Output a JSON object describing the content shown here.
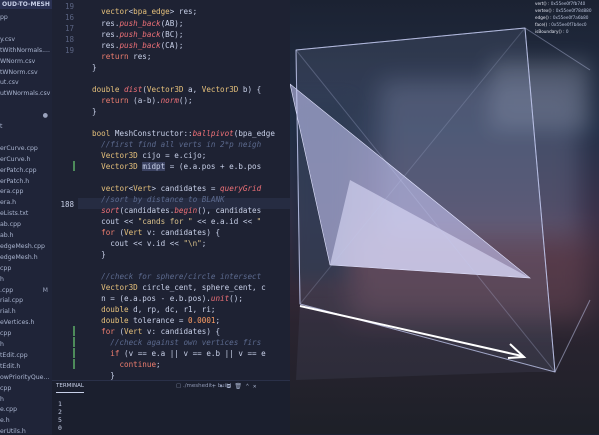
{
  "explorer": {
    "header": "OUD-TO-MESH",
    "files": [
      {
        "name": "pp",
        "marker": ""
      },
      {
        "name": "",
        "marker": ""
      },
      {
        "name": "y.csv",
        "marker": ""
      },
      {
        "name": "tWithNormals....",
        "marker": ""
      },
      {
        "name": "WNorm.csv",
        "marker": ""
      },
      {
        "name": "tWNorm.csv",
        "marker": ""
      },
      {
        "name": "ut.csv",
        "marker": ""
      },
      {
        "name": "utWNormals.csv",
        "marker": ""
      },
      {
        "name": "",
        "marker": ""
      },
      {
        "name": "",
        "marker": "●"
      },
      {
        "name": "t",
        "marker": ""
      },
      {
        "name": "",
        "marker": ""
      },
      {
        "name": "erCurve.cpp",
        "marker": ""
      },
      {
        "name": "erCurve.h",
        "marker": ""
      },
      {
        "name": "erPatch.cpp",
        "marker": ""
      },
      {
        "name": "erPatch.h",
        "marker": ""
      },
      {
        "name": "era.cpp",
        "marker": ""
      },
      {
        "name": "era.h",
        "marker": ""
      },
      {
        "name": "eLists.txt",
        "marker": ""
      },
      {
        "name": "ab.cpp",
        "marker": ""
      },
      {
        "name": "ab.h",
        "marker": ""
      },
      {
        "name": "edgeMesh.cpp",
        "marker": ""
      },
      {
        "name": "edgeMesh.h",
        "marker": ""
      },
      {
        "name": "cpp",
        "marker": ""
      },
      {
        "name": "h",
        "marker": ""
      },
      {
        "name": ".cpp",
        "marker": "M"
      },
      {
        "name": "rial.cpp",
        "marker": ""
      },
      {
        "name": "rial.h",
        "marker": ""
      },
      {
        "name": "eVertices.h",
        "marker": ""
      },
      {
        "name": "cpp",
        "marker": ""
      },
      {
        "name": "h",
        "marker": ""
      },
      {
        "name": "tEdit.cpp",
        "marker": ""
      },
      {
        "name": "tEdit.h",
        "marker": ""
      },
      {
        "name": "owPriorityQue...",
        "marker": ""
      },
      {
        "name": "cpp",
        "marker": ""
      },
      {
        "name": "h",
        "marker": ""
      },
      {
        "name": "e.cpp",
        "marker": ""
      },
      {
        "name": "e.h",
        "marker": ""
      },
      {
        "name": "erUtils.h",
        "marker": ""
      }
    ]
  },
  "editor": {
    "line_numbers": [
      "19",
      "16",
      "17",
      "18",
      "19",
      "",
      "",
      "",
      "",
      "",
      "",
      "",
      "",
      "",
      "",
      "",
      "",
      "",
      "188",
      "",
      "",
      "",
      "",
      "",
      "",
      "",
      "",
      "",
      "",
      "",
      "",
      "",
      "",
      "",
      "",
      ""
    ],
    "current_line": 188
  },
  "terminal": {
    "tab_label": "TERMINAL",
    "task_label": "./meshedit - build",
    "icons": [
      "+",
      "▾",
      "⧉",
      "🗑",
      "⌃",
      "✕"
    ],
    "output": [
      "1",
      "2",
      "5",
      "0"
    ]
  },
  "viewer": {
    "stats": [
      {
        "label": "vert()",
        "value": "0x55ee0f7fb740"
      },
      {
        "label": "vertex()",
        "value": "0x55ee0f78d880"
      },
      {
        "label": "edge()",
        "value": "0x55ee0f7a6b80"
      },
      {
        "label": "face()",
        "value": "0x55ee0f7b4ec0"
      },
      {
        "label": "isBoundary()",
        "value": "0"
      }
    ],
    "colors": {
      "cube_edge": "#c5ccf2",
      "face_fill": "#b7b9f4",
      "arrow": "#ffffff"
    }
  }
}
